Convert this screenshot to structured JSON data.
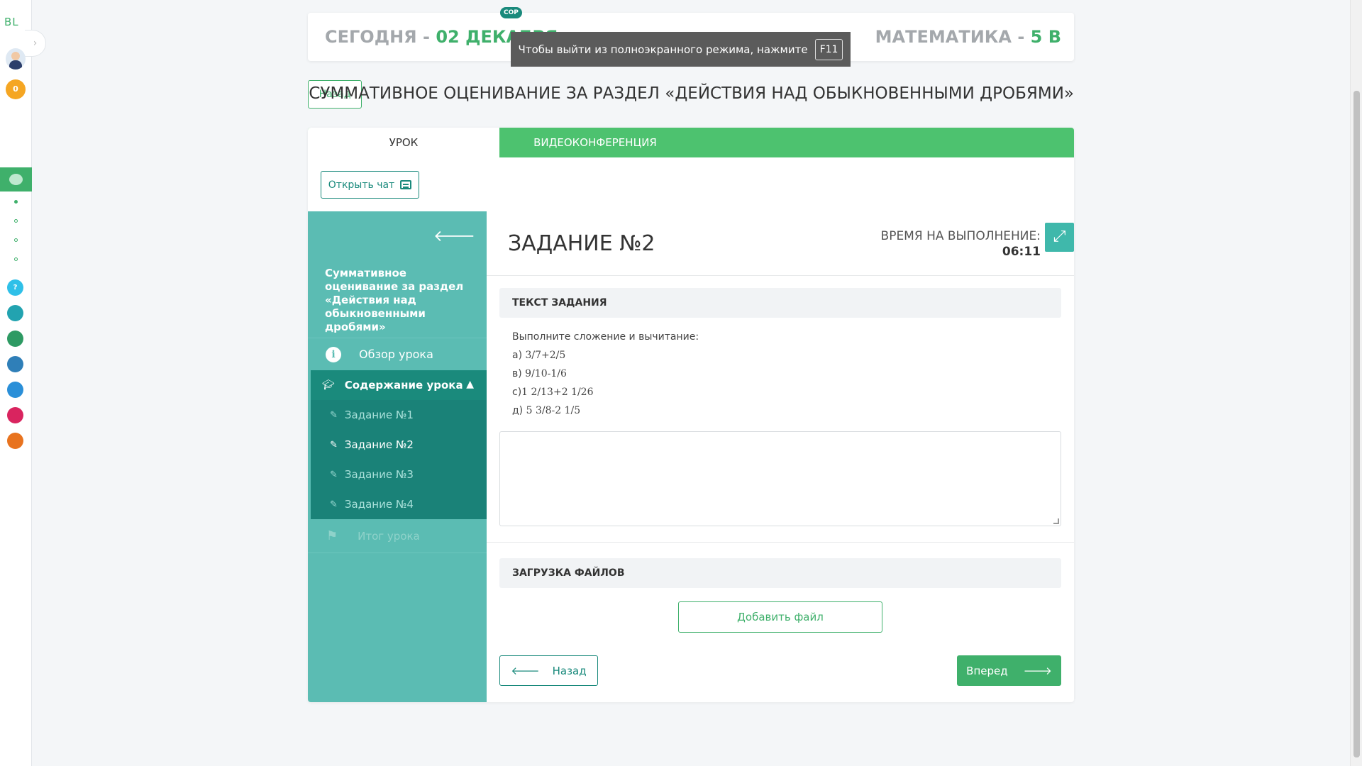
{
  "rail": {
    "logo": "BL",
    "coins": "0"
  },
  "header": {
    "today_label": "СЕГОДНЯ - ",
    "today_date": "02 ДЕКАБРЯ",
    "subject_label": "МАТЕМАТИКА - ",
    "subject_class": "5 В",
    "badge": "СОР"
  },
  "fullscreen_notice": {
    "text": "Чтобы выйти из полноэкранного режима, нажмите",
    "key": "F11"
  },
  "title_row": {
    "back_label": "Назад",
    "title": "СУММАТИВНОЕ ОЦЕНИВАНИЕ ЗА РАЗДЕЛ «ДЕЙСТВИЯ НАД ОБЫКНОВЕННЫМИ ДРОБЯМИ»"
  },
  "tabs": [
    {
      "label": "УРОК",
      "active": true
    },
    {
      "label": "ВИДЕОКОНФЕРЕНЦИЯ",
      "active": false
    }
  ],
  "chat_button": "Открыть чат",
  "sidebar": {
    "title": "Суммативное оценивание за раздел «Действия над обыкновенными дробями»",
    "overview": "Обзор урока",
    "content_header": "Содержание урока",
    "tasks": [
      "Задание №1",
      "Задание №2",
      "Задание №3",
      "Задание №4"
    ],
    "current_task_index": 1,
    "summary": "Итог урока"
  },
  "task": {
    "title": "ЗАДАНИЕ №2",
    "timer_label": "ВРЕМЯ НА ВЫПОЛНЕНИЕ:",
    "timer_value": "06:11",
    "text_header": "ТЕКСТ ЗАДАНИЯ",
    "instruction": "Выполните сложение и вычитание:",
    "items": [
      {
        "prefix": "а) ",
        "expr": "3/7+2/5"
      },
      {
        "prefix": "в) ",
        "expr": "9/10-1/6"
      },
      {
        "prefix": "с)",
        "expr": "1 2/13+2 1/26"
      },
      {
        "prefix": "д) ",
        "expr": "5 3/8-2 1/5"
      }
    ],
    "answer_value": "",
    "upload_header": "ЗАГРУЗКА ФАЙЛОВ",
    "add_file": "Добавить файл",
    "nav_back": "Назад",
    "nav_forward": "Вперед"
  },
  "colors": {
    "accent_green": "#3fb06b",
    "teal": "#5bbcb3",
    "teal_dark": "#1a8a7c"
  }
}
